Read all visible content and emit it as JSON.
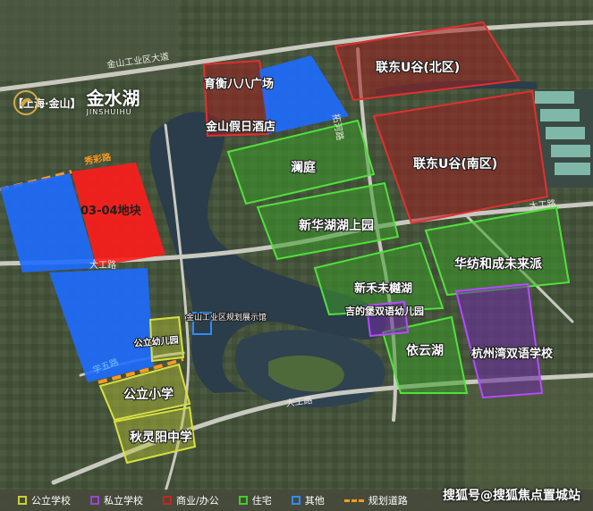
{
  "brand": {
    "region": "【上海·金山】",
    "name": "金水湖",
    "pinyin": "JINSHUIHU"
  },
  "roads": [
    {
      "id": "jinshan-industrial-ave",
      "label": "金山工业区大道"
    },
    {
      "id": "xiucai-rd",
      "label": "秀彩路"
    },
    {
      "id": "tuohe-rd",
      "label": "拓河路"
    },
    {
      "id": "dagong-rd-upper",
      "label": "大工路"
    },
    {
      "id": "dagong-rd-lower",
      "label": "大工路"
    },
    {
      "id": "dagong-rd-right",
      "label": "大工路"
    },
    {
      "id": "xuezhi-rd",
      "label": "学五路"
    }
  ],
  "plots": [
    {
      "id": "yuheng-plaza",
      "label": "育衡八八广场",
      "category": "commercial"
    },
    {
      "id": "jinshan-holiday-hotel",
      "label": "金山假日酒店",
      "category": "commercial"
    },
    {
      "id": "liandong-u-north",
      "label": "联东U谷(北区)",
      "category": "commercial"
    },
    {
      "id": "liandong-u-south",
      "label": "联东U谷(南区)",
      "category": "commercial"
    },
    {
      "id": "lanting",
      "label": "澜庭",
      "category": "residential"
    },
    {
      "id": "xinhua-lake",
      "label": "新华湖湖上园",
      "category": "residential"
    },
    {
      "id": "huafang-future",
      "label": "华纺和成未来派",
      "category": "residential"
    },
    {
      "id": "xinhe-lake",
      "label": "新禾未樾湖",
      "category": "residential"
    },
    {
      "id": "yiyun-lake",
      "label": "依云湖",
      "category": "residential"
    },
    {
      "id": "jide-kindergarten",
      "label": "吉的堡双语幼儿园",
      "category": "private_school"
    },
    {
      "id": "hangzhou-bilingual",
      "label": "杭州湾双语学校",
      "category": "private_school"
    },
    {
      "id": "plot-0304",
      "label": "03-04地块",
      "category": "target"
    },
    {
      "id": "public-kindergarten",
      "label": "公立幼儿园",
      "category": "public_school"
    },
    {
      "id": "public-primary",
      "label": "公立小学",
      "category": "public_school"
    },
    {
      "id": "qiulin-middle",
      "label": "秋灵阳中学",
      "category": "public_school"
    },
    {
      "id": "exhibition-hall",
      "label": "金山工业区规划展示馆",
      "category": "other"
    }
  ],
  "legend": [
    {
      "id": "public_school",
      "label": "公立学校",
      "color": "#c9d12b"
    },
    {
      "id": "private_school",
      "label": "私立学校",
      "color": "#9a45d6"
    },
    {
      "id": "commercial",
      "label": "商业/办公",
      "color": "#cc2222"
    },
    {
      "id": "residential",
      "label": "住宅",
      "color": "#3fcf2a"
    },
    {
      "id": "other",
      "label": "其他",
      "color": "#2f8bff"
    },
    {
      "id": "planned_road",
      "label": "规划道路",
      "color": "#ff9a1f"
    }
  ],
  "colors": {
    "commercial_fill": "#a11f1f",
    "residential_fill": "#3c9b2a",
    "other_fill": "#1e6cff",
    "target_fill": "#ff1c1c",
    "public_fill": "#b7c034",
    "private_fill": "#6a2e9e",
    "water": "#2b3d4a"
  },
  "watermark": "搜狐号@搜狐焦点置城站"
}
